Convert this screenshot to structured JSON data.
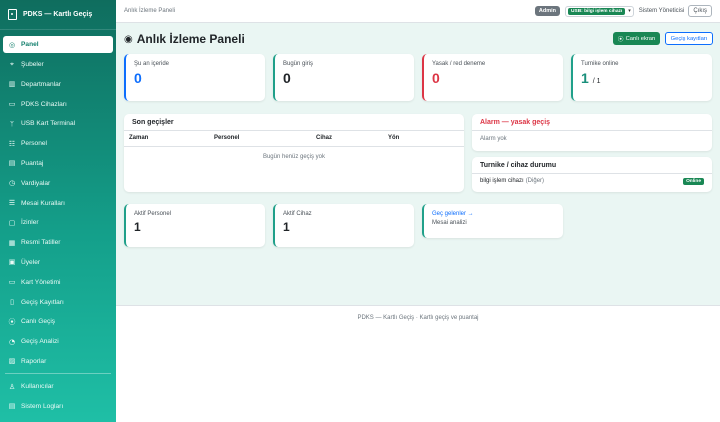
{
  "sidebar": {
    "brand": "PDKS — Kartlı Geçiş",
    "items": [
      {
        "icon": "◎",
        "label": "Panel",
        "active": true
      },
      {
        "icon": "⌖",
        "label": "Şubeler"
      },
      {
        "icon": "▥",
        "label": "Departmanlar"
      },
      {
        "icon": "▭",
        "label": "PDKS Cihazları"
      },
      {
        "icon": "ᛘ",
        "label": "USB Kart Terminal"
      },
      {
        "icon": "☷",
        "label": "Personel"
      },
      {
        "icon": "▤",
        "label": "Puantaj"
      },
      {
        "icon": "◷",
        "label": "Vardiyalar"
      },
      {
        "icon": "☰",
        "label": "Mesai Kuralları"
      },
      {
        "icon": "▢",
        "label": "İzinler"
      },
      {
        "icon": "▦",
        "label": "Resmi Tatiller"
      },
      {
        "icon": "▣",
        "label": "Üyeler"
      },
      {
        "icon": "▭",
        "label": "Kart Yönetimi"
      },
      {
        "icon": "▯",
        "label": "Geçiş Kayıtları"
      },
      {
        "icon": "⦿",
        "label": "Canlı Geçiş"
      },
      {
        "icon": "◔",
        "label": "Geçiş Analizi"
      },
      {
        "icon": "▨",
        "label": "Raporlar"
      }
    ],
    "bottom_items": [
      {
        "icon": "♙",
        "label": "Kullanıcılar"
      },
      {
        "icon": "▤",
        "label": "Sistem Logları"
      }
    ]
  },
  "topbar": {
    "breadcrumb": "Anlık İzleme Paneli",
    "role_badge": "Admin",
    "usb_device": "USB: bilgi işlem cihazı",
    "user": "Sistem Yöneticisi",
    "logout": "Çıkış"
  },
  "page": {
    "title": "Anlık İzleme Paneli",
    "live_button": "Canlı ekran",
    "logs_button": "Geçiş kayıtları"
  },
  "stats": [
    {
      "label": "Şu an içeride",
      "value": "0",
      "color": "#0d6efd"
    },
    {
      "label": "Bugün giriş",
      "value": "0",
      "color": "#20a08a"
    },
    {
      "label": "Yasak / red deneme",
      "value": "0",
      "color": "#dc3545"
    },
    {
      "label": "Turnike online",
      "value": "1",
      "suffix": "/ 1",
      "color": "#20a08a"
    }
  ],
  "recent": {
    "title": "Son geçişler",
    "columns": [
      "Zaman",
      "Personel",
      "Cihaz",
      "Yön"
    ],
    "empty": "Bugün henüz geçiş yok"
  },
  "alarm": {
    "title": "Alarm — yasak geçiş",
    "empty": "Alarm yok"
  },
  "turnstile": {
    "title": "Turnike / cihaz durumu",
    "device": "bilgi işlem cihazı",
    "device_type": "(Diğer)",
    "status": "Online"
  },
  "bottom_stats": [
    {
      "label": "Aktif Personel",
      "value": "1"
    },
    {
      "label": "Aktif Cihaz",
      "value": "1"
    }
  ],
  "late": {
    "link": "Geç gelenler →",
    "sub": "Mesai analizi"
  },
  "footer": "PDKS — Kartlı Geçiş · Kartlı geçiş ve puantaj",
  "colors": {
    "primary": "#0d6efd",
    "success": "#198754",
    "danger": "#dc3545",
    "teal": "#20a08a",
    "sidebar": "#149f8a"
  }
}
